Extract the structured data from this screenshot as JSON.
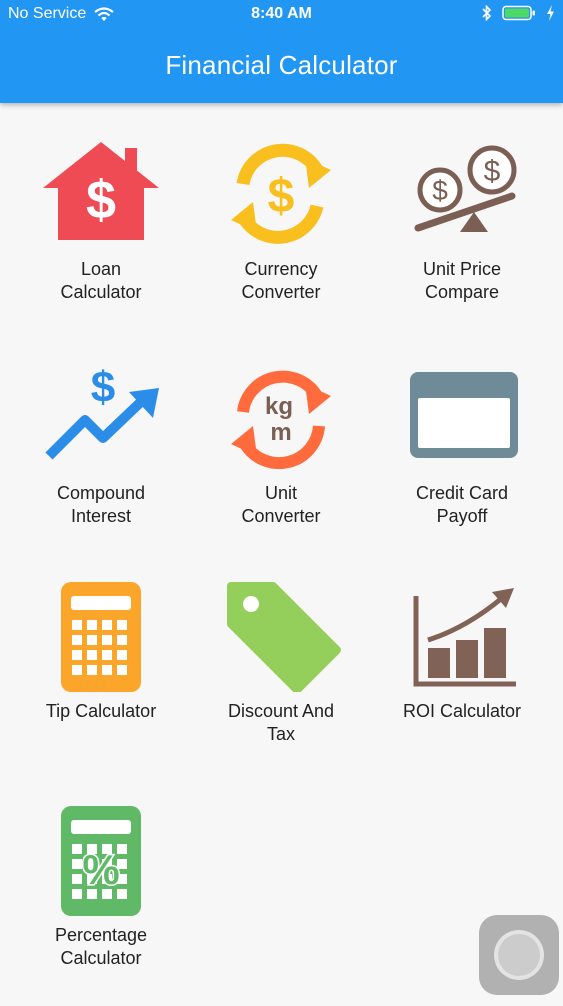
{
  "status_bar": {
    "carrier": "No Service",
    "time": "8:40 AM",
    "icons": [
      "wifi-icon",
      "bluetooth-icon",
      "battery-icon",
      "charging-icon"
    ]
  },
  "header": {
    "title": "Financial Calculator",
    "color": "#2196f3"
  },
  "tiles": [
    {
      "label": "Loan\nCalculator",
      "icon": "house-dollar-icon",
      "color": "#ee4b55"
    },
    {
      "label": "Currency\nConverter",
      "icon": "currency-exchange-icon",
      "color": "#f9bf1f"
    },
    {
      "label": "Unit Price\nCompare",
      "icon": "coins-scale-icon",
      "color": "#7b5f55"
    },
    {
      "label": "Compound\nInterest",
      "icon": "growth-chart-icon",
      "color": "#2c8de8"
    },
    {
      "label": "Unit\nConverter",
      "icon": "kg-m-exchange-icon",
      "color": "#ff6b3d"
    },
    {
      "label": "Credit Card\nPayoff",
      "icon": "credit-card-icon",
      "color": "#6f8b97"
    },
    {
      "label": "Tip Calculator",
      "icon": "calculator-icon",
      "color": "#fba52b"
    },
    {
      "label": "Discount And\nTax",
      "icon": "price-tag-icon",
      "color": "#95cf5b"
    },
    {
      "label": "ROI Calculator",
      "icon": "bar-chart-icon",
      "color": "#806257"
    },
    {
      "label": "Percentage\nCalculator",
      "icon": "percent-calculator-icon",
      "color": "#5fb966"
    }
  ]
}
